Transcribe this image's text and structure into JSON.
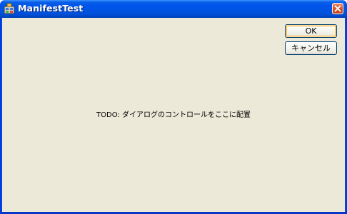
{
  "window": {
    "title": "ManifestTest",
    "icon": "app-window-icon",
    "close_icon": "close-icon"
  },
  "dialog": {
    "ok_label": "OK",
    "cancel_label": "キャンセル",
    "todo_text": "TODO: ダイアログのコントロールをここに配置"
  },
  "colors": {
    "titlebar": "#0054e3",
    "client_background": "#ece9d8",
    "close_button": "#d8562a",
    "default_button_highlight": "#f8b43c"
  }
}
